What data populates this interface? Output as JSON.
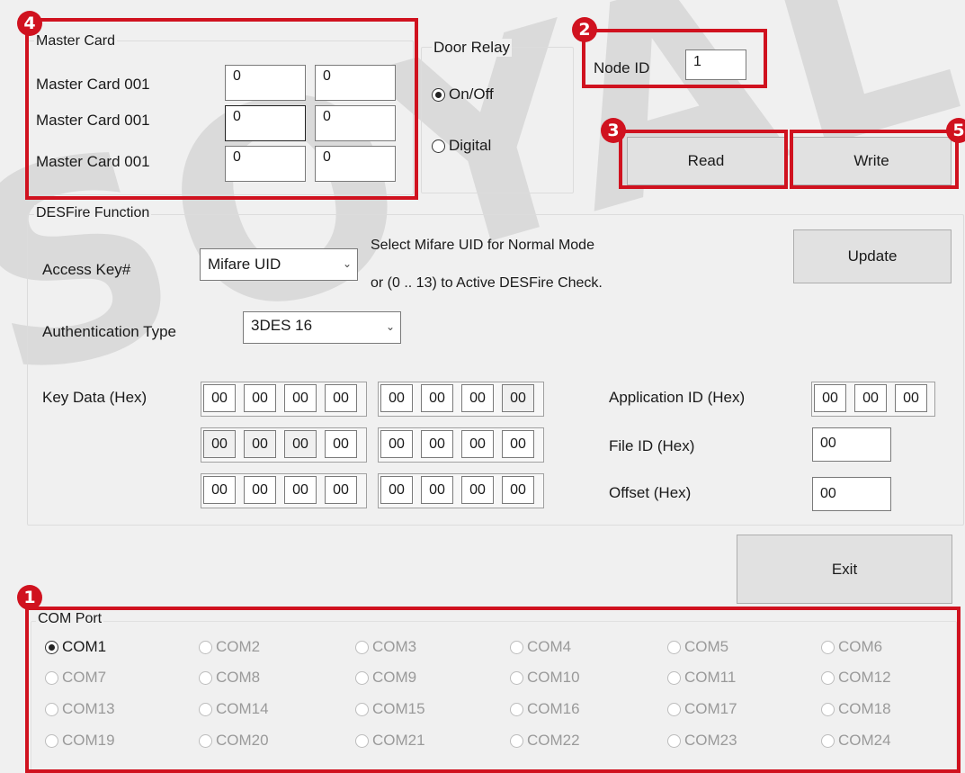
{
  "watermark": "SOYAL",
  "master_card": {
    "group_label": "Master Card",
    "rows": [
      {
        "label": "Master Card 001",
        "a": "0",
        "b": "0"
      },
      {
        "label": "Master Card 001",
        "a": "0",
        "b": "0"
      },
      {
        "label": "Master Card 001",
        "a": "0",
        "b": "0"
      }
    ]
  },
  "door_relay": {
    "group_label": "Door Relay",
    "options": [
      {
        "label": "On/Off",
        "selected": true
      },
      {
        "label": "Digital",
        "selected": false
      }
    ]
  },
  "node": {
    "label": "Node ID",
    "value": "1"
  },
  "buttons": {
    "read": "Read",
    "write": "Write",
    "update": "Update",
    "exit": "Exit"
  },
  "desfire": {
    "group_label": "DESFire Function",
    "access_key_label": "Access Key#",
    "access_key_value": "Mifare UID",
    "hint_line1": "Select  Mifare UID for Normal Mode",
    "hint_line2": "or (0 .. 13) to Active DESFire Check.",
    "auth_label": "Authentication Type",
    "auth_value": "3DES 16",
    "key_data_label": "Key Data   (Hex)",
    "key_rows": [
      [
        "00",
        "00",
        "00",
        "00",
        "00",
        "00",
        "00",
        "00"
      ],
      [
        "00",
        "00",
        "00",
        "00",
        "00",
        "00",
        "00",
        "00"
      ],
      [
        "00",
        "00",
        "00",
        "00",
        "00",
        "00",
        "00",
        "00"
      ]
    ],
    "app_id_label": "Application ID  (Hex)",
    "app_id": [
      "00",
      "00",
      "00"
    ],
    "file_id_label": "File ID    (Hex)",
    "file_id": "00",
    "offset_label": "Offset    (Hex)",
    "offset": "00"
  },
  "com_port": {
    "group_label": "COM Port",
    "ports": [
      "COM1",
      "COM2",
      "COM3",
      "COM4",
      "COM5",
      "COM6",
      "COM7",
      "COM8",
      "COM9",
      "COM10",
      "COM11",
      "COM12",
      "COM13",
      "COM14",
      "COM15",
      "COM16",
      "COM17",
      "COM18",
      "COM19",
      "COM20",
      "COM21",
      "COM22",
      "COM23",
      "COM24"
    ],
    "selected": "COM1"
  },
  "badges": [
    "1",
    "2",
    "3",
    "4",
    "5"
  ],
  "colors": {
    "highlight": "#d0121f",
    "window_bg": "#f0f0f0",
    "button_bg": "#e1e1e1"
  }
}
